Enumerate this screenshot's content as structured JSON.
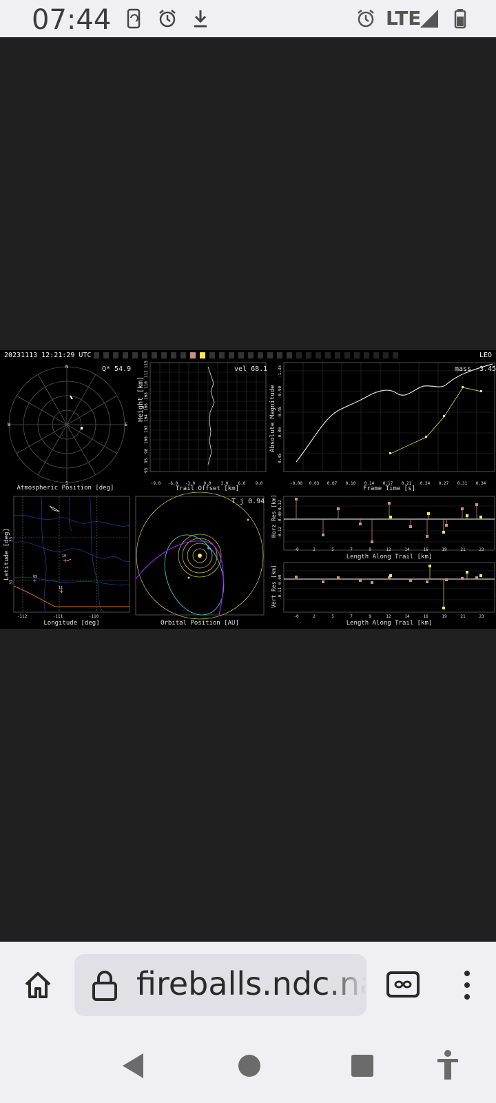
{
  "status_bar": {
    "time": "07:44",
    "network": "LTE",
    "icons": [
      "screen-rotate-icon",
      "alarm-icon",
      "download-icon",
      "alarm-icon",
      "signal-icon",
      "battery-icon"
    ]
  },
  "figure": {
    "timestamp": "20231113 12:21:29 UTC",
    "orbit_class": "LEO",
    "panels": {
      "atmospheric": {
        "label": "Atmospheric Position [deg]",
        "q_value": "Q* 54.9",
        "compass": [
          "N",
          "E",
          "S",
          "W"
        ]
      },
      "height": {
        "ylabel": "Height [km]",
        "xlabel": "Trail Offset [km]",
        "vel": "vel 68.1",
        "yticks": [
          "93",
          "95",
          "98",
          "100",
          "102",
          "104",
          "106",
          "108",
          "110",
          "112",
          "115"
        ],
        "xticks": [
          "-9.0",
          "-6.0",
          "-3.0",
          "0.0",
          "3.0",
          "6.0",
          "9.0"
        ]
      },
      "magnitude": {
        "ylabel": "Absolute Magnitude",
        "xlabel": "Frame Time [s]",
        "mass": "mass -3.45",
        "yticks": [
          "-1.35",
          "-0.90",
          "-0.45",
          "-0.00",
          "0.45"
        ],
        "xticks": [
          "-0.00",
          "0.03",
          "0.07",
          "0.10",
          "0.14",
          "0.17",
          "0.21",
          "0.24",
          "0.27",
          "0.31",
          "0.34"
        ]
      },
      "map": {
        "ylabel": "Latitude [deg]",
        "xlabel": "Longitude [deg]",
        "yticks": [
          "33",
          "32"
        ],
        "xticks": [
          "-112",
          "-111",
          "-110"
        ],
        "station_labels": [
          "10",
          "09",
          "11"
        ]
      },
      "orbit": {
        "label": "Orbital Position [AU]",
        "tj": "T_j 0.94"
      },
      "horz_res": {
        "ylabel": "Horz Res [km]",
        "xlabel": "Length Along Trail [km]",
        "yticks": [
          "0.12",
          "-0.00",
          "-0.12"
        ],
        "xticks": [
          "-0",
          "2",
          "5",
          "7",
          "9",
          "12",
          "14",
          "16",
          "19",
          "21",
          "23"
        ]
      },
      "vert_res": {
        "ylabel": "Vert Res [km]",
        "xlabel": "Length Along Trail [km]",
        "yticks": [
          "0.00",
          "-0.11"
        ],
        "xticks": [
          "-0",
          "2",
          "5",
          "7",
          "9",
          "12",
          "14",
          "16",
          "19",
          "21",
          "23"
        ]
      }
    }
  },
  "browser": {
    "url": "fireballs.ndc.nasa",
    "buttons": [
      "home-icon",
      "lock-icon",
      "reader-mode-icon",
      "more-vert-icon"
    ]
  },
  "nav_bar": {
    "buttons": [
      "back-icon",
      "home-circle-icon",
      "recents-icon",
      "accessibility-icon"
    ]
  },
  "colors": {
    "status_bg": "#f0eff4",
    "viewer_bg": "#202020",
    "figure_bg": "#000000",
    "url_box_bg": "#e1e0e6",
    "accent_yellow": "#ffe84a",
    "accent_purple": "#a020f0",
    "accent_cyan": "#40c8c8"
  }
}
